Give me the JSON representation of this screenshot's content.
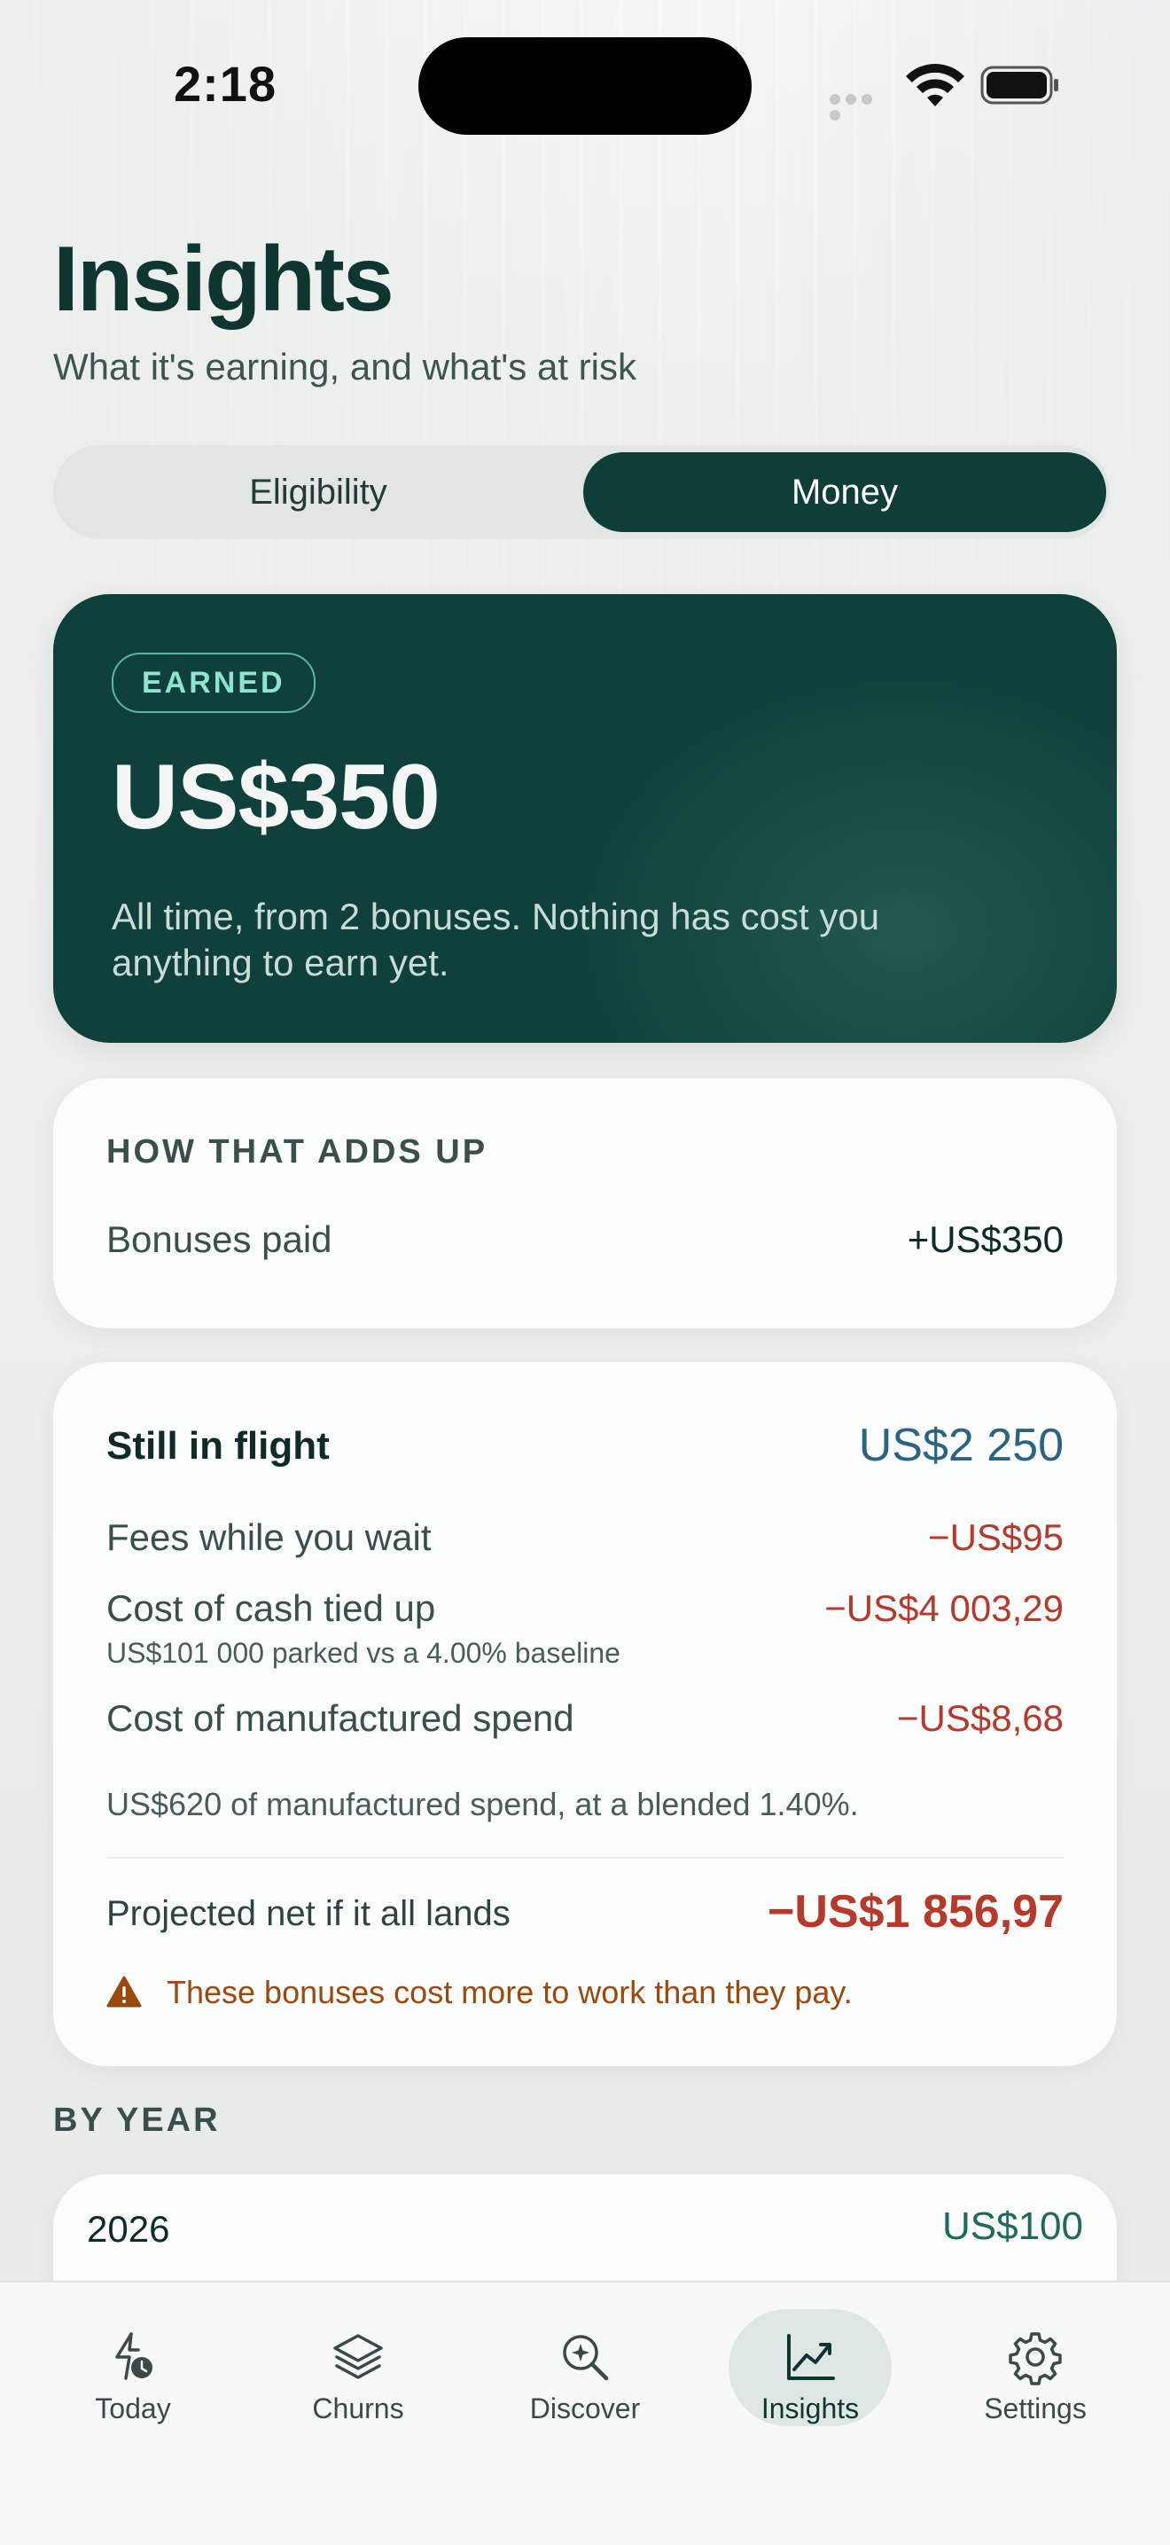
{
  "status_bar": {
    "time": "2:18"
  },
  "header": {
    "title": "Insights",
    "subtitle": "What it's earning, and what's at risk"
  },
  "segment": {
    "options": [
      {
        "label": "Eligibility",
        "selected": false
      },
      {
        "label": "Money",
        "selected": true
      }
    ]
  },
  "hero": {
    "badge": "EARNED",
    "amount": "US$350",
    "description": "All time, from 2 bonuses. Nothing has cost you anything to earn yet."
  },
  "adds_up": {
    "heading": "HOW THAT ADDS UP",
    "rows": [
      {
        "label": "Bonuses paid",
        "value": "+US$350"
      }
    ]
  },
  "in_flight": {
    "title": "Still in flight",
    "total": "US$2 250",
    "rows": [
      {
        "label": "Fees while you wait",
        "value": "−US$95"
      },
      {
        "label": "Cost of cash tied up",
        "value": "−US$4 003,29",
        "note": "US$101 000 parked vs a 4.00% baseline"
      },
      {
        "label": "Cost of manufactured spend",
        "value": "−US$8,68"
      }
    ],
    "spend_note": "US$620 of manufactured spend, at a blended 1.40%.",
    "projected_label": "Projected net if it all lands",
    "projected_value": "−US$1 856,97",
    "warning": "These bonuses cost more to work than they pay."
  },
  "by_year": {
    "heading": "BY YEAR",
    "rows": [
      {
        "year": "2026",
        "value": "US$100"
      }
    ]
  },
  "tabbar": {
    "tabs": [
      {
        "label": "Today",
        "icon": "bolt-clock-icon",
        "active": false
      },
      {
        "label": "Churns",
        "icon": "layers-icon",
        "active": false
      },
      {
        "label": "Discover",
        "icon": "magnifier-sparkle-icon",
        "active": false
      },
      {
        "label": "Insights",
        "icon": "chart-trend-icon",
        "active": true
      },
      {
        "label": "Settings",
        "icon": "gear-icon",
        "active": false
      }
    ]
  },
  "colors": {
    "accent": "#0f3d38",
    "negative": "#b53a2c",
    "positive": "#1f6a5a",
    "info": "#2b6382",
    "warning": "#9b4a0f"
  }
}
